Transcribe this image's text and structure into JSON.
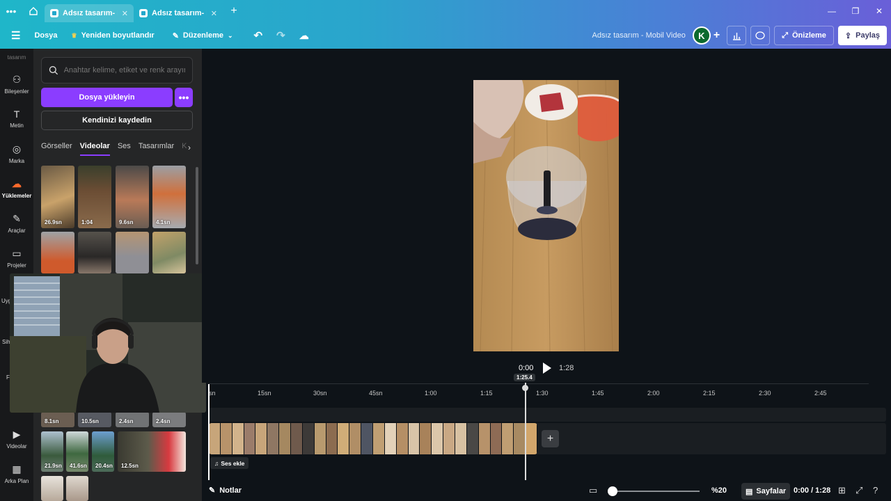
{
  "browser": {
    "tabs": [
      {
        "label": "Adsız tasarım- Mob..."
      },
      {
        "label": "Adsız tasarım- Mob..."
      }
    ]
  },
  "header": {
    "file": "Dosya",
    "resize": "Yeniden boyutlandır",
    "edit": "Düzenleme",
    "title": "Adsız tasarım - Mobil Video",
    "avatar": "K",
    "preview": "Önizleme",
    "share": "Paylaş"
  },
  "rail": {
    "top_label": "tasarım",
    "items": [
      {
        "label": "Bileşenler",
        "icon": "elements-icon"
      },
      {
        "label": "Metin",
        "icon": "text-icon"
      },
      {
        "label": "Marka",
        "icon": "brand-icon"
      },
      {
        "label": "Yüklemeler",
        "icon": "uploads-icon"
      },
      {
        "label": "Araçlar",
        "icon": "draw-icon"
      },
      {
        "label": "Projeler",
        "icon": "folder-icon"
      },
      {
        "label": "Uyg",
        "icon": "apps-icon"
      },
      {
        "label": "Sih",
        "icon": "magic-icon"
      },
      {
        "label": "F",
        "icon": "photos-icon"
      },
      {
        "label": "Videolar",
        "icon": "video-icon"
      },
      {
        "label": "Arka Plan",
        "icon": "background-icon"
      }
    ]
  },
  "panel": {
    "search_placeholder": "Anahtar kelime, etiket ve renk arayın",
    "upload": "Dosya yükleyin",
    "more": "•••",
    "record": "Kendinizi kaydedin",
    "categories": [
      "Görseller",
      "Videolar",
      "Ses",
      "Tasarımlar",
      "K"
    ],
    "active_category": "Videolar",
    "thumbs_row1": [
      "26.9sn",
      "1:04",
      "9.6sn",
      "4.1sn"
    ],
    "thumbs_row3": [
      "8.1sn",
      "10.5sn",
      "2.4sn",
      "2.4sn"
    ],
    "thumbs_row4": [
      "21.9sn",
      "41.6sn",
      "20.4sn",
      "12.5sn"
    ]
  },
  "playback": {
    "current": "0:00",
    "total": "1:28",
    "playhead_label": "1:25.4"
  },
  "ruler": {
    "ticks": [
      "sn",
      "15sn",
      "30sn",
      "45sn",
      "1:00",
      "1:15",
      "1:30",
      "1:45",
      "2:00",
      "2:15",
      "2:30",
      "2:45"
    ]
  },
  "timeline": {
    "add_audio": "Ses ekle",
    "add_clip": "+"
  },
  "footer": {
    "notes": "Notlar",
    "zoom": "%20",
    "pages": "Sayfalar",
    "time": "0:00 / 1:28"
  },
  "colors": {
    "accent": "#8b3dff",
    "header_gradient_start": "#1fb6c9",
    "header_gradient_end": "#6a5fd8"
  }
}
